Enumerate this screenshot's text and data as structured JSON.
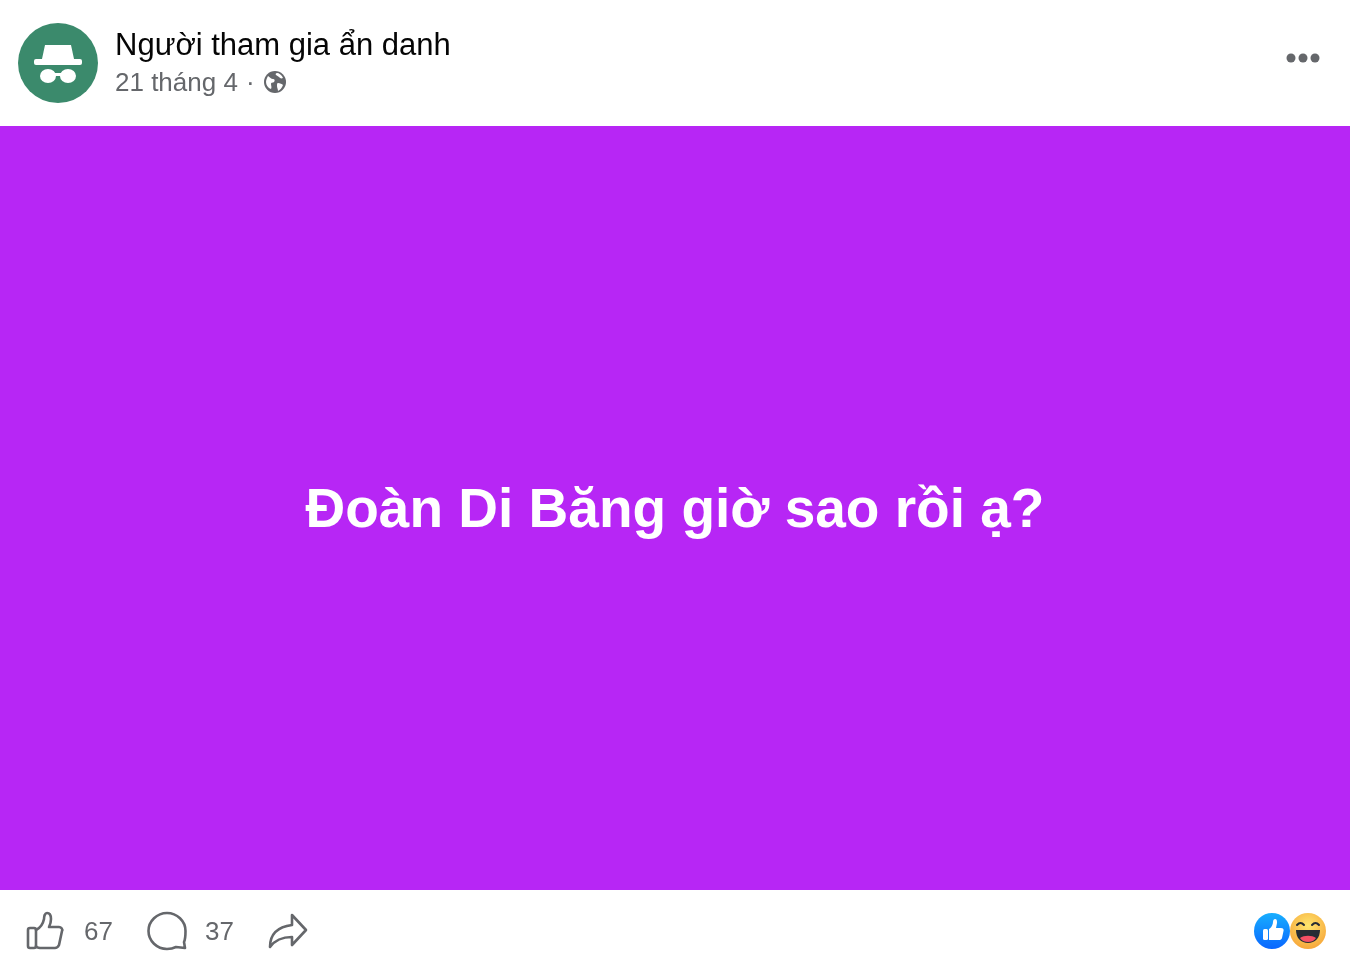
{
  "post": {
    "author": "Người tham gia ẩn danh",
    "date": "21 tháng 4",
    "separator": "·",
    "body": {
      "text": "Đoàn Di Băng giờ sao rồi ạ?"
    },
    "actions": [
      {
        "kind": "like",
        "count": "67"
      },
      {
        "kind": "comment",
        "count": "37"
      },
      {
        "kind": "share"
      }
    ],
    "reactions": [
      {
        "kind": "like"
      },
      {
        "kind": "haha"
      }
    ]
  }
}
